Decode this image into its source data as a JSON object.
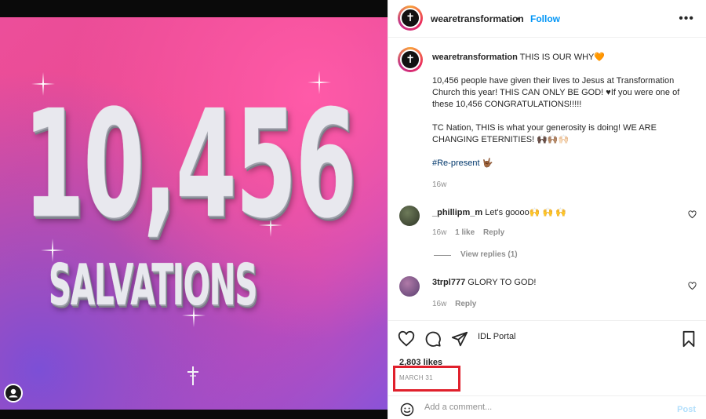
{
  "post_image": {
    "number_text": "10,456",
    "subtitle_text": "SALVATIONS",
    "logo": "cross-icon"
  },
  "header": {
    "username": "wearetransformation",
    "separator": "•",
    "follow_label": "Follow",
    "more_icon": "more-horizontal-icon"
  },
  "caption": {
    "username": "wearetransformation",
    "title": "THIS IS OUR WHY🧡",
    "para1": "10,456 people have given their lives to Jesus at Transformation Church this year! THIS CAN ONLY BE GOD! ♥If you were one of these 10,456 CONGRATULATIONS!!!!!",
    "para2": "TC Nation, THIS is what your generosity is doing! WE ARE CHANGING ETERNITIES! 🙌🏿🙌🏽🙌🏻",
    "hashtag": "#Re-present",
    "hashtag_emoji": "🤟🏾",
    "time": "16w"
  },
  "comments": [
    {
      "username": "_phillipm_m",
      "text": "Let's goooo🙌 🙌 🙌",
      "time": "16w",
      "likes": "1 like",
      "reply_label": "Reply"
    },
    {
      "username": "3trpl777",
      "text": "GLORY TO GOD!",
      "time": "16w",
      "reply_label": "Reply"
    }
  ],
  "view_replies": "View replies (1)",
  "actions": {
    "portal_label": "IDL Portal"
  },
  "likes_text": "2,803 likes",
  "date_text": "MARCH 31",
  "add_comment": {
    "placeholder": "Add a comment...",
    "post_label": "Post"
  },
  "colors": {
    "follow_blue": "#0095f6",
    "post_disabled": "#b2dffc",
    "highlight_red": "#e0202c",
    "hashtag": "#00376b"
  }
}
